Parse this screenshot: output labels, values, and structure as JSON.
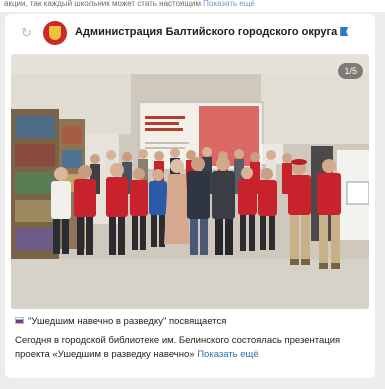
{
  "top_snippet": {
    "text": "акции, ",
    "tail": "так каждый школьник может стать настоящим",
    "more": "Показать ещё"
  },
  "post": {
    "org_name": "Администрация Балтийского городского округа",
    "photo_counter": "1/5",
    "projector_screen_title": "УШЕДШИМ НАВЕЧНО В РАЗВЕДКУ",
    "title": "\"Ушедшим навечно в разведку\" посвящается",
    "body": "Сегодня в городской библиотеке им. Белинского состоялась презентация проекта «Ушедшим в разведку навечно»",
    "show_more": "Показать ещё"
  },
  "icons": {
    "refresh": "refresh-icon",
    "flag": "flag-icon",
    "ru_flag": "russia-flag-icon"
  },
  "colors": {
    "link": "#2a6fb3",
    "uniform_red": "#c8232c",
    "card_bg": "#ffffff",
    "page_bg": "#ececec"
  }
}
